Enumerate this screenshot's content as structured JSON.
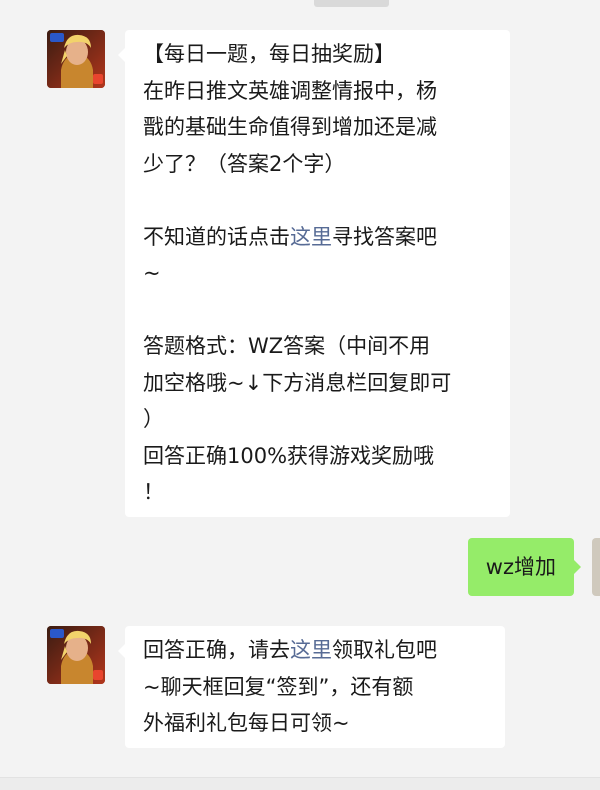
{
  "messages": [
    {
      "sender": "other",
      "lines": [
        {
          "text": "【每日一题，每日抽奖励】"
        },
        {
          "text": "在昨日推文英雄调整情报中，杨"
        },
        {
          "text": "戬的基础生命值得到增加还是减"
        },
        {
          "text": "少了？（答案2个字）"
        },
        {
          "blank": true
        },
        {
          "before": "不知道的话点击",
          "link": "这里",
          "after": "寻找答案吧"
        },
        {
          "text": "~"
        },
        {
          "blank": true
        },
        {
          "text": "答题格式：WZ答案（中间不用"
        },
        {
          "text": "加空格哦~↓下方消息栏回复即可"
        },
        {
          "text": "）"
        },
        {
          "text": "回答正确100%获得游戏奖励哦"
        },
        {
          "text": "！"
        }
      ]
    },
    {
      "sender": "self",
      "text": "wz增加"
    },
    {
      "sender": "other",
      "lines": [
        {
          "before": "回答正确，请去",
          "link": "这里",
          "after": "领取礼包吧"
        },
        {
          "text": "~聊天框回复“签到”，还有额"
        },
        {
          "text": "外福利礼包每日可领~"
        }
      ]
    }
  ],
  "colors": {
    "background": "#f3f3f3",
    "received_bubble": "#ffffff",
    "sent_bubble": "#95ec69",
    "link": "#576b95"
  },
  "avatar_icon": "game-hero-avatar-icon"
}
